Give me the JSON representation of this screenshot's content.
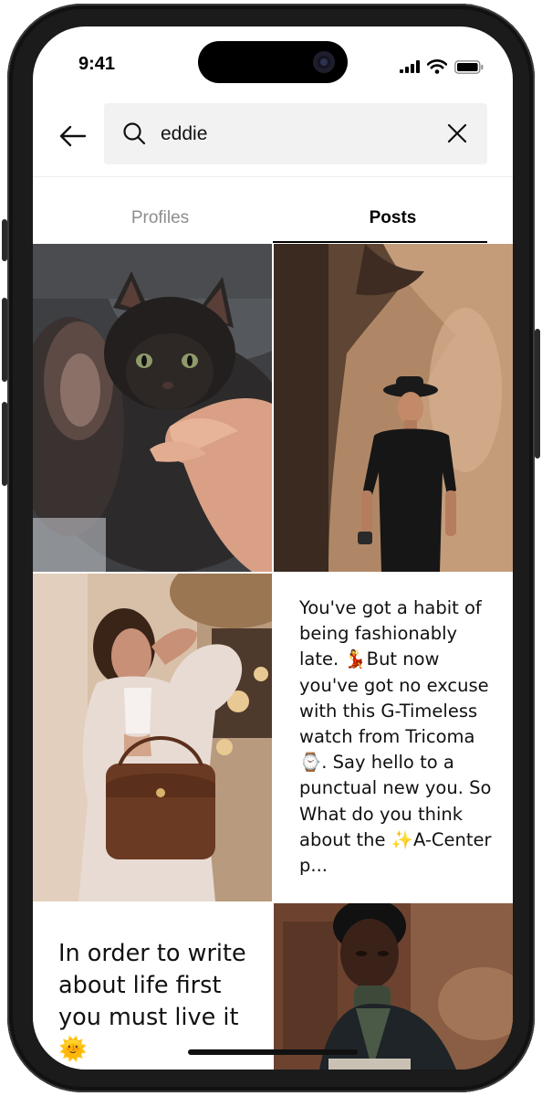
{
  "status_bar": {
    "time": "9:41"
  },
  "search": {
    "query": "eddie",
    "placeholder": ""
  },
  "tabs": [
    {
      "label": "Profiles",
      "active": false
    },
    {
      "label": "Posts",
      "active": true
    }
  ],
  "posts": [
    {
      "type": "image",
      "subject": "kitten being petted"
    },
    {
      "type": "image",
      "subject": "man in black hat against canyon wall"
    },
    {
      "type": "image",
      "subject": "woman with brown leather handbag"
    },
    {
      "type": "text",
      "text": "You've got a habit of being fashionably late. 💃But now you've got no excuse with this G-Timeless watch from Tricoma⌚. Say hello to a punctual new you. So What do you think about the ✨A-Center p..."
    },
    {
      "type": "text",
      "text": "In order to write about life first you must live it 🌞"
    },
    {
      "type": "image",
      "subject": "man in turtleneck and blazer reading"
    }
  ],
  "colors": {
    "accent": "#000000",
    "inactive_tab": "#8d8d8d",
    "search_bg": "#f2f2f2"
  }
}
